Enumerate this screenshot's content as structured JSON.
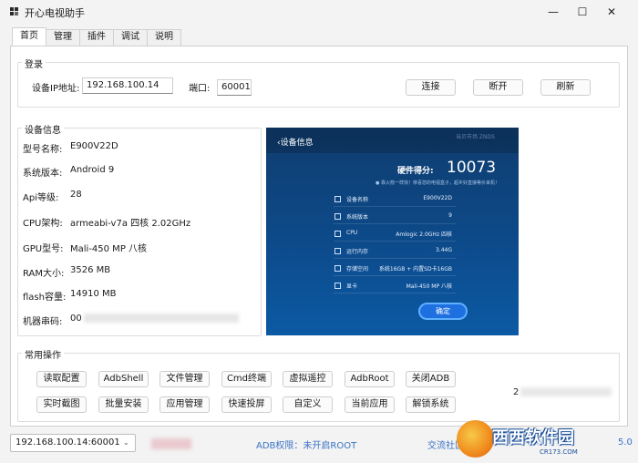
{
  "window": {
    "title": "开心电视助手",
    "minimize_glyph": "—",
    "maximize_glyph": "☐",
    "close_glyph": "✕"
  },
  "tabs": [
    {
      "label": "首页",
      "active": true
    },
    {
      "label": "管理",
      "active": false
    },
    {
      "label": "插件",
      "active": false
    },
    {
      "label": "调试",
      "active": false
    },
    {
      "label": "说明",
      "active": false
    }
  ],
  "login": {
    "title": "登录",
    "ip_label": "设备IP地址:",
    "ip_value": "192.168.100.14",
    "port_label": "端口:",
    "port_value": "60001",
    "connect_btn": "连接",
    "disconnect_btn": "断开",
    "refresh_btn": "刷新"
  },
  "device_info": {
    "title": "设备信息",
    "rows": [
      {
        "label": "型号名称:",
        "value": "E900V22D"
      },
      {
        "label": "系统版本:",
        "value": "Android 9"
      },
      {
        "label": "Api等级:",
        "value": "28"
      },
      {
        "label": "CPU架构:",
        "value": "armeabi-v7a 四核 2.02GHz"
      },
      {
        "label": "GPU型号:",
        "value": "Mali-450 MP 八核"
      },
      {
        "label": "RAM大小:",
        "value": "3526 MB"
      },
      {
        "label": "flash容量:",
        "value": "14910 MB"
      },
      {
        "label": "机器串码:",
        "value": "00"
      }
    ]
  },
  "screen": {
    "back_title": "‹设备信息",
    "brand": "当贝市场  ZNDS",
    "score_label": "硬件得分:",
    "score_value": "10073",
    "hint": "● 靠火箭一样快！恭喜您的电视盒子，超乡好直接等价来机！",
    "rows": [
      {
        "key": "设备名称",
        "value": "E900V22D"
      },
      {
        "key": "系统版本",
        "value": "9"
      },
      {
        "key": "CPU",
        "value": "Amlogic 2.0GHz 四核"
      },
      {
        "key": "运行内存",
        "value": "3.44G"
      },
      {
        "key": "存储空间",
        "value": "系统16GB + 内置SD卡16GB"
      },
      {
        "key": "显卡",
        "value": "Mali-450 MP 八核"
      }
    ],
    "ok_btn": "确定"
  },
  "ops": {
    "title": "常用操作",
    "row1": [
      "读取配置",
      "AdbShell",
      "文件管理",
      "Cmd终端",
      "虚拟遥控",
      "AdbRoot",
      "关闭ADB"
    ],
    "row2": [
      "实时截图",
      "批量安装",
      "应用管理",
      "快速投屏",
      "自定义",
      "当前应用",
      "解锁系统"
    ],
    "side_value": "2"
  },
  "status": {
    "device_select": "192.168.100.14:60001",
    "combo_arrow": "⌄",
    "adb_status": "ADB权限：未开启ROOT",
    "community": "交流社区",
    "version_tail": "5.0"
  },
  "watermark": {
    "brand_text": "西西软件园",
    "site": "CR173.COM"
  },
  "colors": {
    "accent_link": "#3a73c6",
    "screen_bg": "#0d4a8a",
    "ok_button": "#1e6fe0"
  }
}
